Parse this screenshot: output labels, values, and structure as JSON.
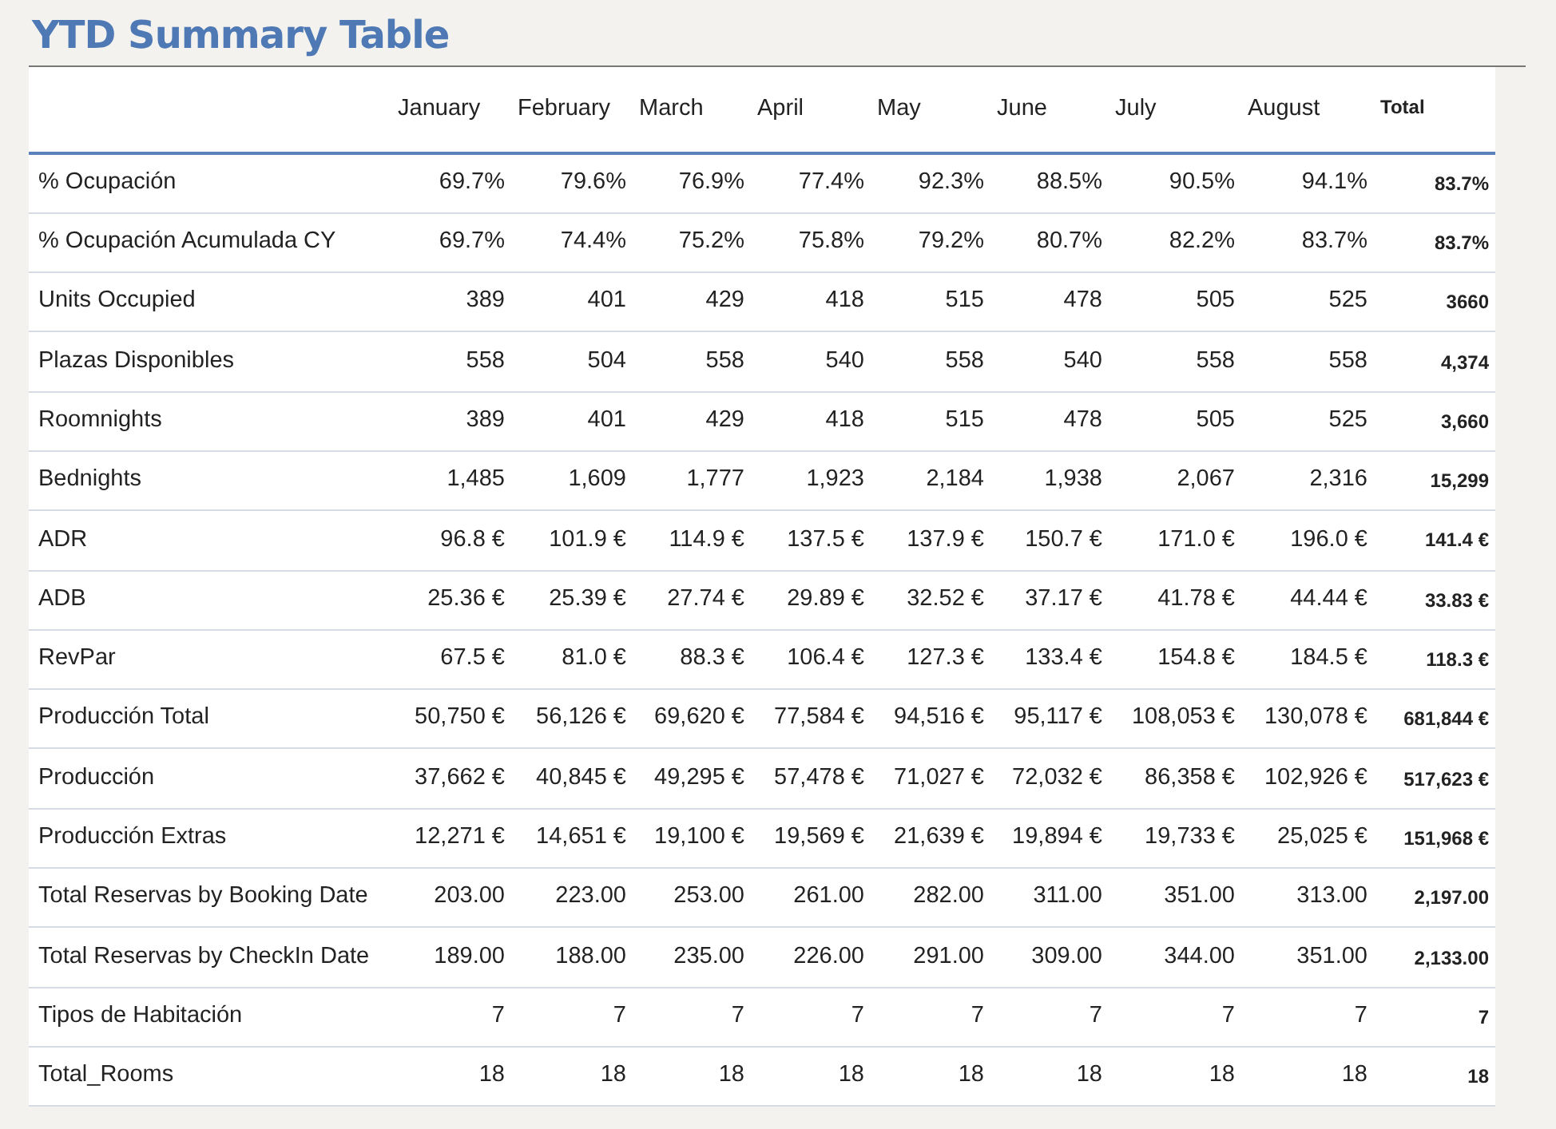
{
  "title": "YTD Summary Table",
  "table": {
    "columns": [
      "January",
      "February",
      "March",
      "April",
      "May",
      "June",
      "July",
      "August",
      "Total"
    ],
    "rows": [
      {
        "label": "% Ocupación",
        "values": [
          "69.7%",
          "79.6%",
          "76.9%",
          "77.4%",
          "92.3%",
          "88.5%",
          "90.5%",
          "94.1%",
          "83.7%"
        ]
      },
      {
        "label": "% Ocupación Acumulada CY",
        "values": [
          "69.7%",
          "74.4%",
          "75.2%",
          "75.8%",
          "79.2%",
          "80.7%",
          "82.2%",
          "83.7%",
          "83.7%"
        ]
      },
      {
        "label": "Units Occupied",
        "values": [
          "389",
          "401",
          "429",
          "418",
          "515",
          "478",
          "505",
          "525",
          "3660"
        ]
      },
      {
        "label": "Plazas Disponibles",
        "values": [
          "558",
          "504",
          "558",
          "540",
          "558",
          "540",
          "558",
          "558",
          "4,374"
        ]
      },
      {
        "label": "Roomnights",
        "values": [
          "389",
          "401",
          "429",
          "418",
          "515",
          "478",
          "505",
          "525",
          "3,660"
        ]
      },
      {
        "label": "Bednights",
        "values": [
          "1,485",
          "1,609",
          "1,777",
          "1,923",
          "2,184",
          "1,938",
          "2,067",
          "2,316",
          "15,299"
        ]
      },
      {
        "label": "ADR",
        "values": [
          "96.8 €",
          "101.9 €",
          "114.9 €",
          "137.5 €",
          "137.9 €",
          "150.7 €",
          "171.0 €",
          "196.0 €",
          "141.4 €"
        ]
      },
      {
        "label": "ADB",
        "values": [
          "25.36 €",
          "25.39 €",
          "27.74 €",
          "29.89 €",
          "32.52 €",
          "37.17 €",
          "41.78 €",
          "44.44 €",
          "33.83 €"
        ]
      },
      {
        "label": "RevPar",
        "values": [
          "67.5 €",
          "81.0 €",
          "88.3 €",
          "106.4 €",
          "127.3 €",
          "133.4 €",
          "154.8 €",
          "184.5 €",
          "118.3 €"
        ]
      },
      {
        "label": "Producción Total",
        "values": [
          "50,750 €",
          "56,126 €",
          "69,620 €",
          "77,584 €",
          "94,516 €",
          "95,117 €",
          "108,053 €",
          "130,078 €",
          "681,844 €"
        ]
      },
      {
        "label": "Producción",
        "values": [
          "37,662 €",
          "40,845 €",
          "49,295 €",
          "57,478 €",
          "71,027 €",
          "72,032 €",
          "86,358 €",
          "102,926 €",
          "517,623 €"
        ]
      },
      {
        "label": "Producción Extras",
        "values": [
          "12,271 €",
          "14,651 €",
          "19,100 €",
          "19,569 €",
          "21,639 €",
          "19,894 €",
          "19,733 €",
          "25,025 €",
          "151,968 €"
        ]
      },
      {
        "label": "Total Reservas by Booking Date",
        "values": [
          "203.00",
          "223.00",
          "253.00",
          "261.00",
          "282.00",
          "311.00",
          "351.00",
          "313.00",
          "2,197.00"
        ]
      },
      {
        "label": "Total Reservas by CheckIn Date",
        "values": [
          "189.00",
          "188.00",
          "235.00",
          "226.00",
          "291.00",
          "309.00",
          "344.00",
          "351.00",
          "2,133.00"
        ]
      },
      {
        "label": "Tipos de Habitación",
        "values": [
          "7",
          "7",
          "7",
          "7",
          "7",
          "7",
          "7",
          "7",
          "7"
        ]
      },
      {
        "label": "Total_Rooms",
        "values": [
          "18",
          "18",
          "18",
          "18",
          "18",
          "18",
          "18",
          "18",
          "18"
        ]
      }
    ]
  }
}
